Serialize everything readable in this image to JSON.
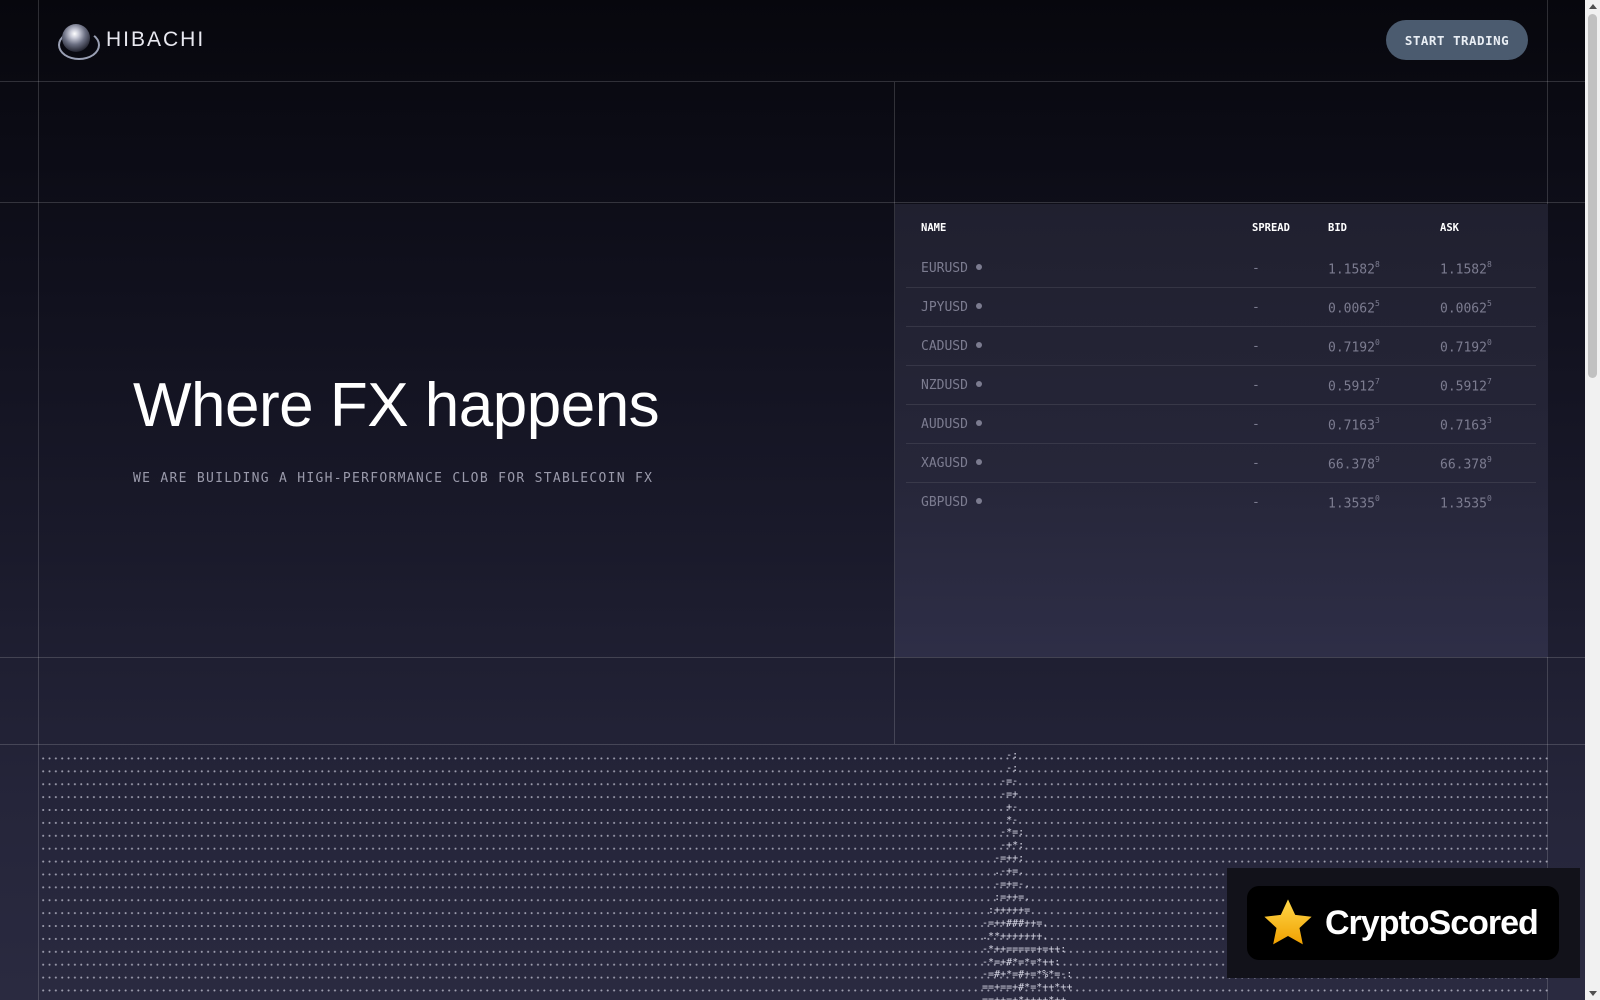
{
  "header": {
    "logo_text": "HIBACHI",
    "cta_label": "START TRADING"
  },
  "hero": {
    "title": "Where FX happens",
    "subtitle": "WE ARE BUILDING A HIGH-PERFORMANCE CLOB FOR STABLECOIN FX"
  },
  "table": {
    "columns": [
      "NAME",
      "SPREAD",
      "BID",
      "ASK"
    ],
    "rows": [
      {
        "name": "EURUSD",
        "spread": "-",
        "bid": "1.1582",
        "bid_sup": "8",
        "ask": "1.1582",
        "ask_sup": "8"
      },
      {
        "name": "JPYUSD",
        "spread": "-",
        "bid": "0.0062",
        "bid_sup": "5",
        "ask": "0.0062",
        "ask_sup": "5"
      },
      {
        "name": "CADUSD",
        "spread": "-",
        "bid": "0.7192",
        "bid_sup": "0",
        "ask": "0.7192",
        "ask_sup": "0"
      },
      {
        "name": "NZDUSD",
        "spread": "-",
        "bid": "0.5912",
        "bid_sup": "7",
        "ask": "0.5912",
        "ask_sup": "7"
      },
      {
        "name": "AUDUSD",
        "spread": "-",
        "bid": "0.7163",
        "bid_sup": "3",
        "ask": "0.7163",
        "ask_sup": "3"
      },
      {
        "name": "XAGUSD",
        "spread": "-",
        "bid": "66.378",
        "bid_sup": "9",
        "ask": "66.378",
        "ask_sup": "9"
      },
      {
        "name": "GBPUSD",
        "spread": "-",
        "bid": "1.3535",
        "bid_sup": "0",
        "ask": "1.3535",
        "ask_sup": "0"
      }
    ]
  },
  "badge": {
    "text": "CryptoScored"
  },
  "colors": {
    "button_bg": "#4b5b6f",
    "badge_star": "#f5b400"
  }
}
